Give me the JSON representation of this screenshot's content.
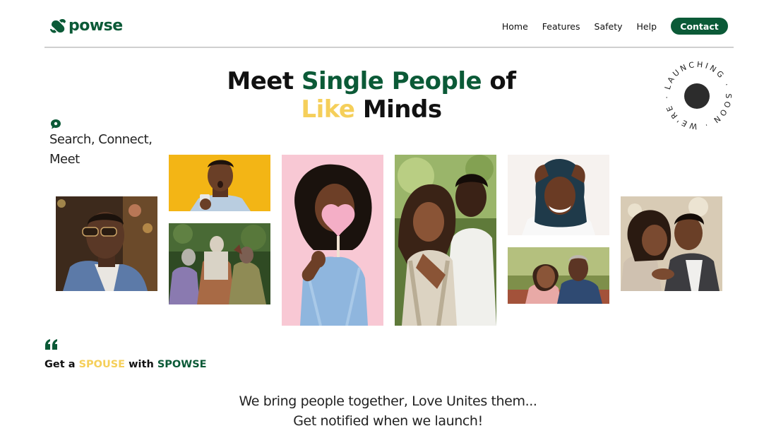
{
  "brand": {
    "logo_text": "powse",
    "logo_icon": "s-logo-icon",
    "primary_color": "#0b5a37",
    "accent_color": "#f5cf5a"
  },
  "nav": {
    "items": [
      {
        "label": "Home"
      },
      {
        "label": "Features"
      },
      {
        "label": "Safety"
      },
      {
        "label": "Help"
      }
    ],
    "contact_label": "Contact"
  },
  "hero": {
    "line1_a": "Meet ",
    "line1_b": "Single People",
    "line1_c": " of",
    "line2_a": "Like",
    "line2_b": " Minds"
  },
  "badge": {
    "text": "LAUNCHING · SOON · WE'RE ·"
  },
  "tagline": {
    "icon": "chat-bubble-icon",
    "line1": "Search, Connect,",
    "line2": "Meet"
  },
  "photos": [
    {
      "desc": "man-sunglasses-photo"
    },
    {
      "desc": "surprised-man-phone-photo"
    },
    {
      "desc": "group-friends-photo"
    },
    {
      "desc": "woman-heart-photo"
    },
    {
      "desc": "couple-hug-photo"
    },
    {
      "desc": "woman-hijab-photo"
    },
    {
      "desc": "older-couple-photo"
    },
    {
      "desc": "couple-forehead-photo"
    }
  ],
  "slogan": {
    "icon": "quote-icon",
    "a": "Get a ",
    "b": "SPOUSE",
    "c": " with ",
    "d": "SPOWSE"
  },
  "footer": {
    "line1": "We bring people together, Love Unites them...",
    "line2": "Get notified when we launch!"
  }
}
